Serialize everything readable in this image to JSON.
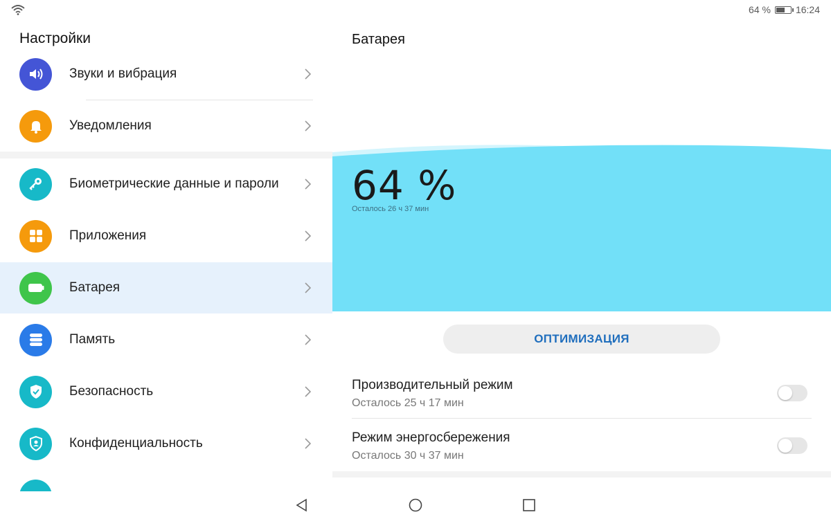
{
  "statusbar": {
    "battery_text": "64 %",
    "time": "16:24",
    "battery_level": 0.64,
    "icons": [
      "wifi-icon",
      "battery-icon"
    ]
  },
  "settings": {
    "title": "Настройки",
    "items": [
      {
        "label": "Звуки и вибрация",
        "icon": "speaker-icon",
        "color": "#4455d6"
      },
      {
        "label": "Уведомления",
        "icon": "bell-icon",
        "color": "#f59a0c"
      },
      {
        "label": "Биометрические данные и пароли",
        "icon": "key-icon",
        "color": "#17b9c8"
      },
      {
        "label": "Приложения",
        "icon": "apps-grid-icon",
        "color": "#f59a0c"
      },
      {
        "label": "Батарея",
        "icon": "battery-icon",
        "color": "#3fc54a",
        "selected": true
      },
      {
        "label": "Память",
        "icon": "storage-icon",
        "color": "#2a7be8"
      },
      {
        "label": "Безопасность",
        "icon": "shield-check-icon",
        "color": "#17b9c8"
      },
      {
        "label": "Конфиденциальность",
        "icon": "privacy-shield-icon",
        "color": "#17b9c8"
      }
    ]
  },
  "battery": {
    "title": "Батарея",
    "percent": "64 %",
    "remaining": "Осталось 26 ч 37 мин",
    "wave_color": "#72e0f8",
    "optimize_label": "ОПТИМИЗАЦИЯ",
    "modes": [
      {
        "title": "Производительный режим",
        "subtitle": "Осталось 25 ч 17 мин",
        "enabled": false
      },
      {
        "title": "Режим энергосбережения",
        "subtitle": "Осталось 30 ч 37 мин",
        "enabled": false
      }
    ]
  },
  "navbar": {
    "icons": [
      "back-icon",
      "home-icon",
      "recents-icon"
    ]
  }
}
